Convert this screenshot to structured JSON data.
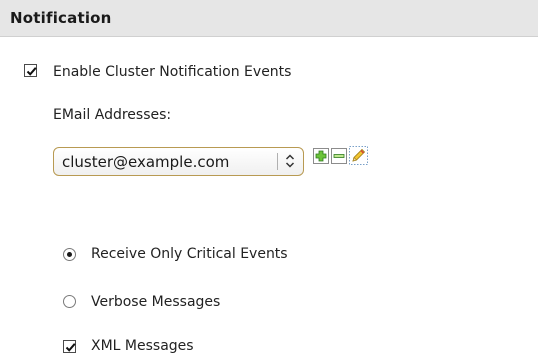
{
  "section": {
    "title": "Notification"
  },
  "enable_events": {
    "label": "Enable Cluster Notification Events",
    "checked": true
  },
  "email": {
    "label": "EMail Addresses:",
    "selected": "cluster@example.com",
    "add_icon": "add-icon",
    "remove_icon": "remove-icon",
    "edit_icon": "edit-icon"
  },
  "event_level": {
    "options": [
      {
        "label": "Receive Only Critical Events",
        "selected": true
      },
      {
        "label": "Verbose Messages",
        "selected": false
      }
    ]
  },
  "xml_messages": {
    "label": "XML Messages",
    "checked": true
  },
  "colors": {
    "header_bg": "#e6e6e6",
    "select_border": "#b89a52",
    "add_green": "#3a9a2a",
    "edit_pencil": "#e8b800"
  }
}
